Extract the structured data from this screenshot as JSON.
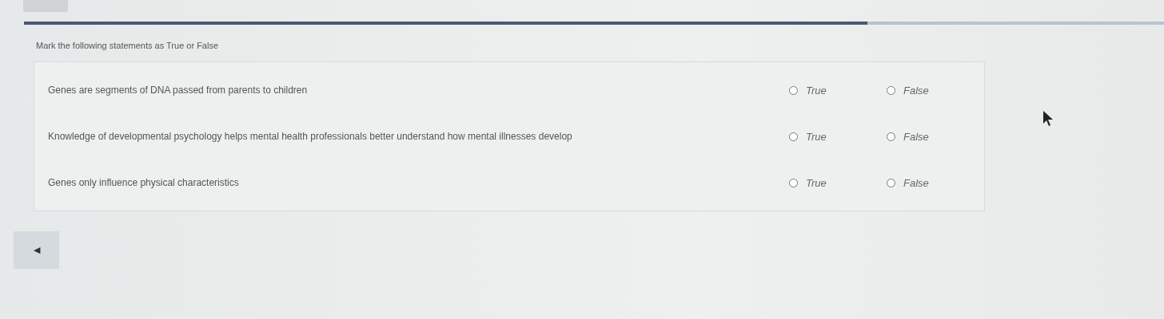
{
  "progress": {
    "level": 0.74
  },
  "instruction": "Mark the following statements as True or False",
  "statements": [
    {
      "text": "Genes are segments of DNA passed from parents to children",
      "options": [
        {
          "label": "True",
          "selected": false
        },
        {
          "label": "False",
          "selected": false
        }
      ]
    },
    {
      "text": "Knowledge of developmental psychology helps mental health professionals better understand how mental illnesses develop",
      "options": [
        {
          "label": "True",
          "selected": false
        },
        {
          "label": "False",
          "selected": false
        }
      ]
    },
    {
      "text": "Genes only influence physical characteristics",
      "options": [
        {
          "label": "True",
          "selected": false
        },
        {
          "label": "False",
          "selected": false
        }
      ]
    }
  ],
  "back_button": {
    "label": "◀"
  }
}
